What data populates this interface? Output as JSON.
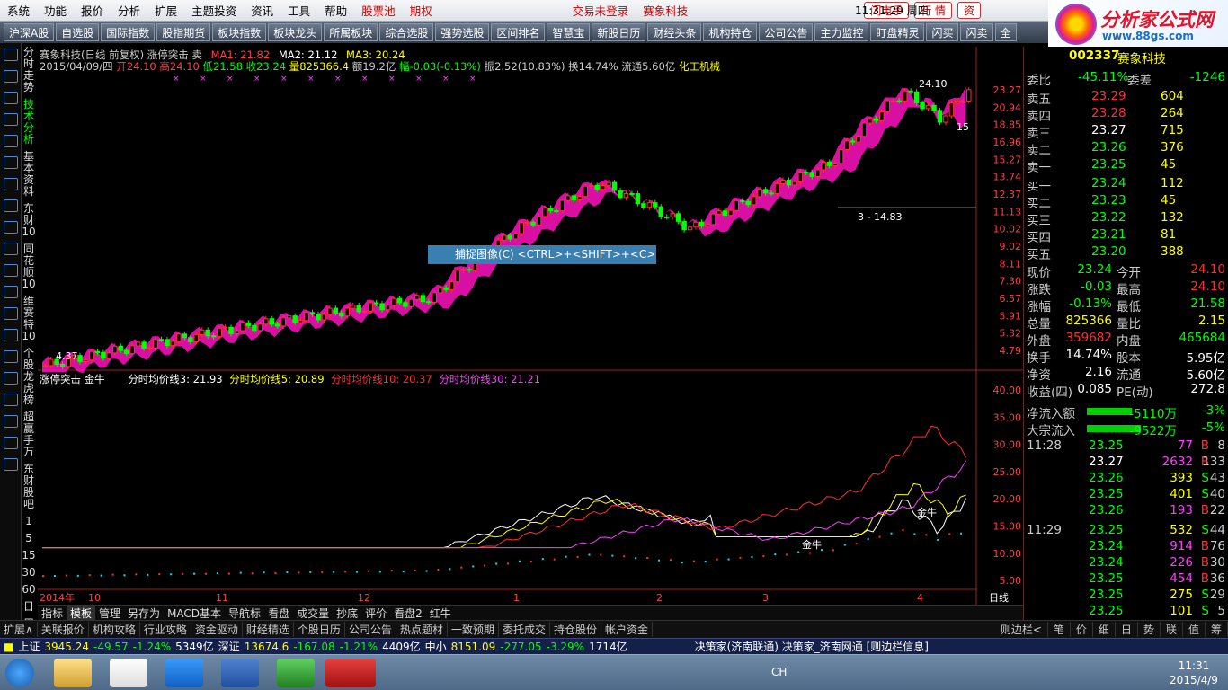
{
  "menu": {
    "items": [
      "系统",
      "功能",
      "报价",
      "分析",
      "扩展",
      "主题投资",
      "资讯",
      "工具",
      "帮助"
    ],
    "pool": "股票池",
    "futures": "期权",
    "login": "交易未登录",
    "brand": "赛象科技",
    "clock": "11:31:29 周四",
    "flash": "闪电手",
    "market": "行 情",
    "trade": "资"
  },
  "toolbar": [
    "沪深A股",
    "自选股",
    "国际指数",
    "股指期货",
    "板块指数",
    "板块龙头",
    "所属板块",
    "综合选股",
    "强势选股",
    "区间排名",
    "智慧宝",
    "新股日历",
    "财经头条",
    "机构持仓",
    "公司公告",
    "主力监控",
    "盯盘精灵",
    "闪买",
    "闪卖",
    "全"
  ],
  "logo": {
    "name": "分析家公式网",
    "url": "www.88gs.com"
  },
  "vtabs": [
    "分时走势",
    "技术分析",
    "基本资料",
    "东财10",
    "同花顺10",
    "维赛特10",
    "个股龙虎榜",
    "超赢手万",
    "东财股吧",
    "1",
    "5",
    "15",
    "30",
    "60",
    "日",
    "周"
  ],
  "price_panel": {
    "title": "赛象科技(日线 前复权) 涨停突击 卖",
    "ma1": "MA1: 21.82",
    "ma2": "MA2: 21.12",
    "ma3": "MA3: 20.24",
    "info": {
      "date": "2015/04/09/四",
      "open": "开24.10",
      "high": "高24.10",
      "low": "低21.58",
      "close": "收23.24",
      "vol": "量825366.4",
      "amt": "额19.2亿",
      "chg": "幅-0.03(-0.13%)",
      "amp": "振2.52(10.83%)",
      "turn": "换14.74%",
      "flow": "流通5.60亿",
      "sector": "化工机械"
    },
    "axis": [
      "23.27",
      "20.94",
      "18.85",
      "16.96",
      "15.27",
      "13.74",
      "12.37",
      "11.13",
      "10.02",
      "9.02",
      "8.11",
      "7.30",
      "6.57",
      "5.91",
      "5.32",
      "4.79"
    ],
    "marks": [
      "24.10",
      "15",
      "3 - 14.83",
      "4.37"
    ]
  },
  "ind_panel": {
    "title": "涨停突击 金牛",
    "l1": "分时均价线3: 21.93",
    "l2": "分时均价线5: 20.89",
    "l3": "分时均价线10: 20.37",
    "l4": "分时均价线30: 21.21",
    "axis": [
      "40.00",
      "35.00",
      "30.00",
      "25.00",
      "20.00",
      "15.00",
      "10.00",
      "5.00"
    ],
    "label1": "金牛",
    "label2": "金牛"
  },
  "xaxis": [
    "2014年",
    "10",
    "11",
    "12",
    "1",
    "2",
    "3",
    "4"
  ],
  "capture": "捕捉图像(C)  <CTRL>+<SHIFT>+<C>",
  "ctrl_icons": [
    "日线"
  ],
  "tabs": [
    "指标",
    "模板",
    "管理",
    "另存为",
    "MACD基本",
    "导航标",
    "看盘",
    "成交量",
    "抄底",
    "评价",
    "看盘2",
    "红牛"
  ],
  "bottom": [
    "扩展∧",
    "关联报价",
    "机构攻略",
    "行业攻略",
    "资金驱动",
    "财经精选",
    "个股日历",
    "公司公告",
    "热点题材",
    "一致预期",
    "委托成交",
    "持仓股份",
    "帐户资金"
  ],
  "bottom_right": [
    "则边栏<",
    "笔",
    "价",
    "细",
    "日",
    "势",
    "联",
    "值",
    "筹"
  ],
  "quote": {
    "code": "002337",
    "name": "赛象科技",
    "wb": {
      "label": "委比",
      "val": "-45.11%",
      "label2": "委差",
      "val2": "-1246"
    },
    "asks": [
      [
        "卖五",
        "23.29",
        "604"
      ],
      [
        "卖四",
        "23.28",
        "264"
      ],
      [
        "卖三",
        "23.27",
        "715"
      ],
      [
        "卖二",
        "23.26",
        "376"
      ],
      [
        "卖一",
        "23.25",
        "45"
      ]
    ],
    "bids": [
      [
        "买一",
        "23.24",
        "112"
      ],
      [
        "买二",
        "23.23",
        "45"
      ],
      [
        "买三",
        "23.22",
        "132"
      ],
      [
        "买四",
        "23.21",
        "81"
      ],
      [
        "买五",
        "23.20",
        "388"
      ]
    ],
    "stats": [
      [
        "现价",
        "23.24",
        "今开",
        "24.10"
      ],
      [
        "涨跌",
        "-0.03",
        "最高",
        "24.10"
      ],
      [
        "涨幅",
        "-0.13%",
        "最低",
        "21.58"
      ],
      [
        "总量",
        "825366",
        "量比",
        "2.15"
      ],
      [
        "外盘",
        "359682",
        "内盘",
        "465684"
      ],
      [
        "换手",
        "14.74%",
        "股本",
        "5.95亿"
      ],
      [
        "净资",
        "2.16",
        "流通",
        "5.60亿"
      ],
      [
        "收益(四)",
        "0.085",
        "PE(动)",
        "272.8"
      ]
    ],
    "flow": [
      [
        "净流入额",
        "-5110万",
        "-3%"
      ],
      [
        "大宗流入",
        "-9522万",
        "-5%"
      ]
    ],
    "ticks": [
      [
        "11:28",
        "23.25",
        "77",
        "B",
        "8"
      ],
      [
        "",
        "23.27",
        "2632",
        "B",
        "133"
      ],
      [
        "",
        "23.26",
        "393",
        "S",
        "43"
      ],
      [
        "",
        "23.25",
        "401",
        "S",
        "40"
      ],
      [
        "",
        "23.26",
        "193",
        "B",
        "22"
      ],
      [
        "11:29",
        "23.25",
        "532",
        "S",
        "44"
      ],
      [
        "",
        "23.24",
        "914",
        "B",
        "76"
      ],
      [
        "",
        "23.24",
        "226",
        "B",
        "30"
      ],
      [
        "",
        "23.25",
        "454",
        "B",
        "36"
      ],
      [
        "",
        "23.25",
        "275",
        "S",
        "29"
      ],
      [
        "",
        "23.25",
        "101",
        "S",
        "5"
      ]
    ]
  },
  "status": {
    "sh": "上证",
    "sh_v": "3945.24",
    "sh_c": "-49.57",
    "sh_p": "-1.24%",
    "sh_a": "5349亿",
    "sz": "深证",
    "sz_v": "13674.6",
    "sz_c": "-167.08",
    "sz_p": "-1.21%",
    "sz_a": "4409亿",
    "zx": "中小",
    "zx_v": "8151.09",
    "zx_c": "-277.05",
    "zx_p": "-3.29%",
    "zx_a": "1714亿",
    "msg": "决策家(济南联通) 决策家_济南网通 [则边栏信息]"
  },
  "taskbar": {
    "time": "11:31",
    "date": "2015/4/9",
    "lang": "CH"
  },
  "colors": {
    "up": "#ff3030",
    "down": "#00e0ff",
    "green": "#00ff00",
    "yellow": "#ffff00",
    "magenta": "#ff40ff"
  }
}
